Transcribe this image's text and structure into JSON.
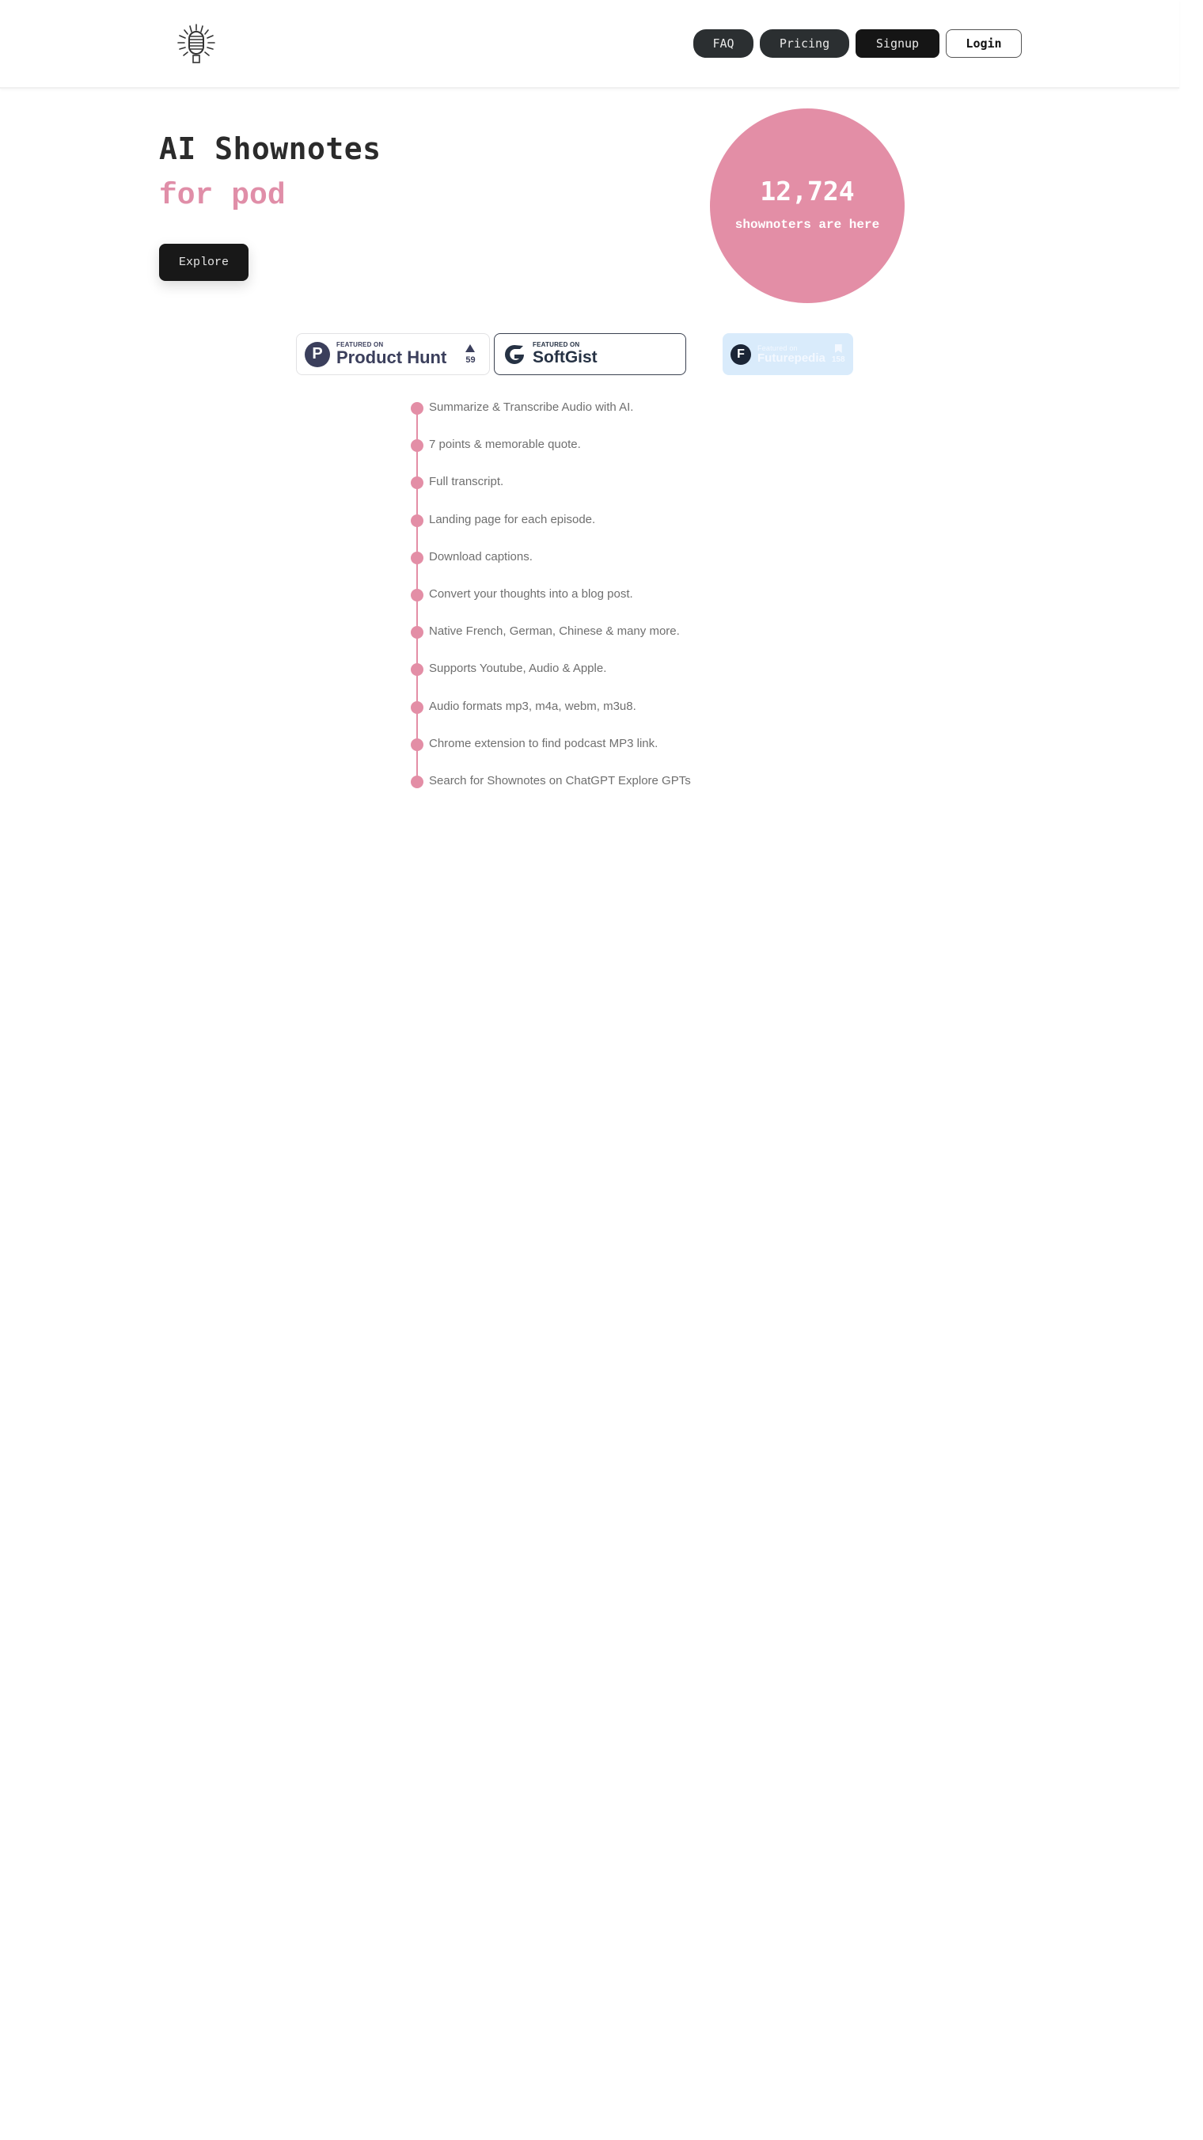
{
  "header": {
    "logo_icon": "microphone-icon",
    "nav": [
      {
        "label": "FAQ"
      },
      {
        "label": "Pricing"
      },
      {
        "label": "Signup"
      },
      {
        "label": "Login"
      }
    ]
  },
  "hero": {
    "title": "AI Shownotes",
    "subtitle": "for pod",
    "cta_label": "Explore",
    "accent_color": "#e38ea6"
  },
  "counter": {
    "value": "12,724",
    "label": "shownoters are here"
  },
  "badges": [
    {
      "name": "Product Hunt",
      "small": "FEATURED ON",
      "big": "Product Hunt",
      "votes": "59",
      "icon": "product-hunt-icon"
    },
    {
      "name": "SoftGist",
      "small": "FEATURED ON",
      "big": "SoftGist",
      "icon": "softgist-icon"
    },
    {
      "name": "Futurepedia",
      "small": "Featured on",
      "big": "Futurepedia",
      "count": "158",
      "icon": "futurepedia-icon"
    }
  ],
  "features": [
    "Summarize & Transcribe Audio with AI.",
    "7 points & memorable quote.",
    "Full transcript.",
    "Landing page for each episode.",
    "Download captions.",
    "Convert your thoughts into a blog post.",
    "Native French, German, Chinese & many more.",
    "Supports Youtube, Audio & Apple.",
    "Audio formats mp3, m4a, webm, m3u8.",
    "Chrome extension to find podcast MP3 link.",
    "Search for Shownotes on ChatGPT Explore GPTs"
  ]
}
